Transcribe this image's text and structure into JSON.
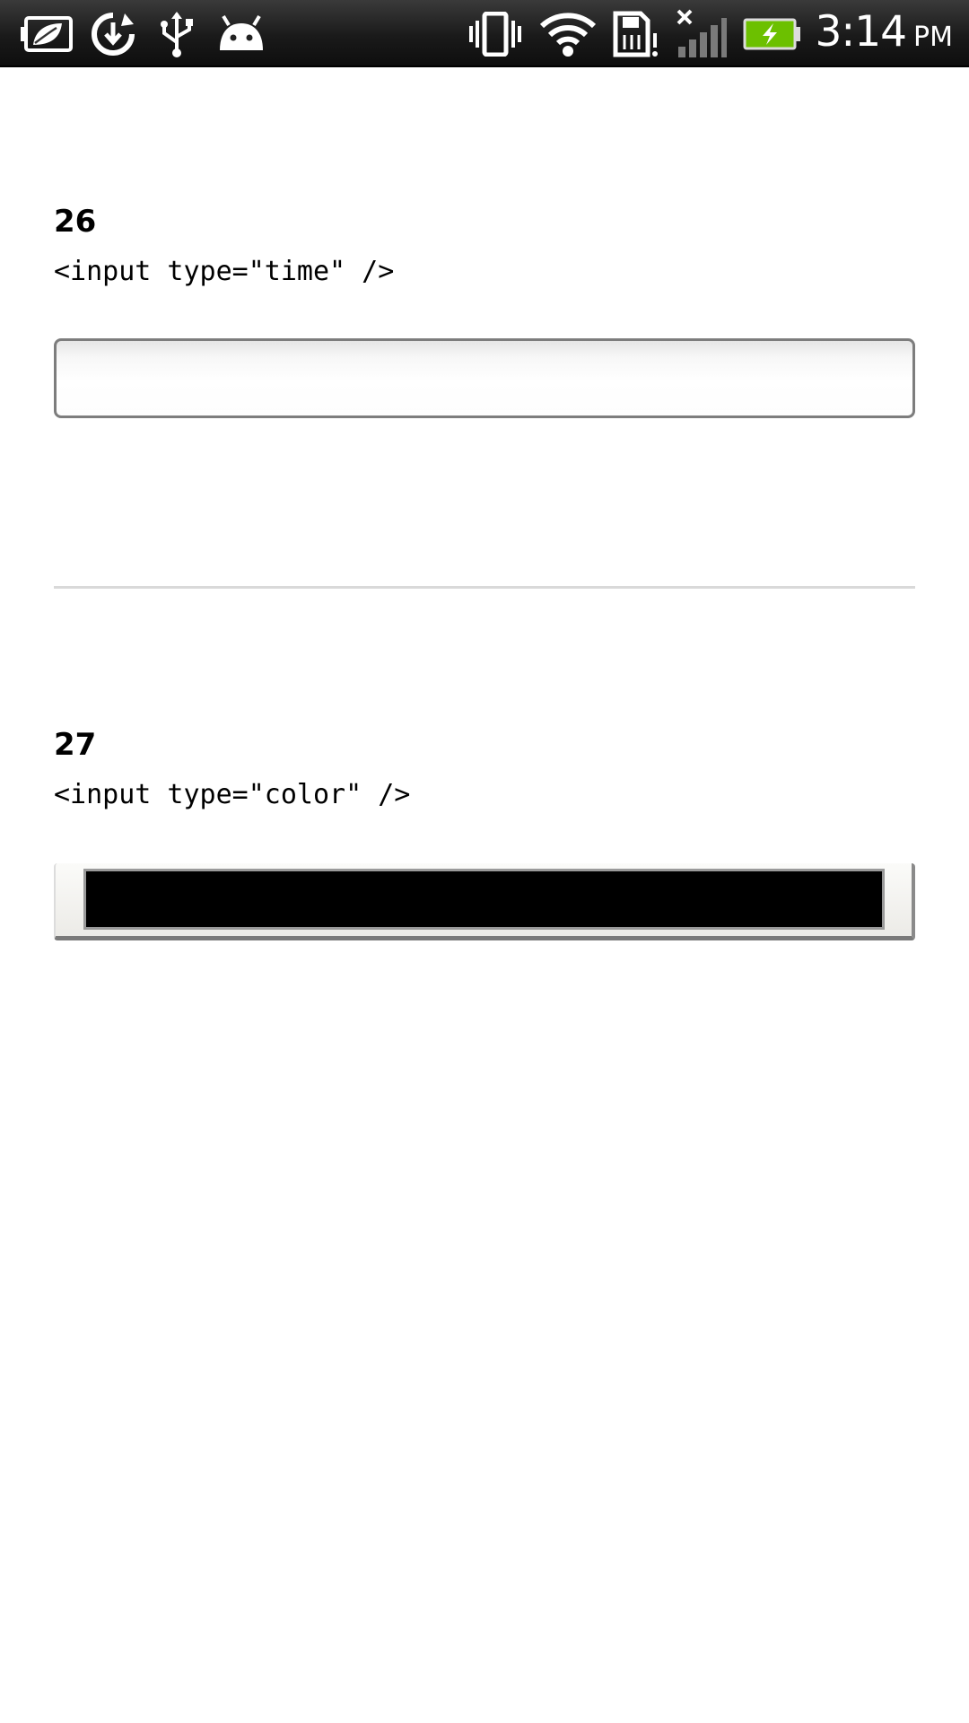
{
  "status_bar": {
    "time": "3:14",
    "ampm": "PM",
    "left_icons": [
      "leaf-notification-icon",
      "sync-icon",
      "usb-icon",
      "android-debug-icon"
    ],
    "right_icons": [
      "vibrate-icon",
      "wifi-icon",
      "sd-card-warning-icon",
      "no-signal-icon",
      "battery-charging-icon"
    ],
    "colors": {
      "background": "#1c1c1c",
      "battery_fill": "#6cc000",
      "icon": "#ffffff"
    }
  },
  "sections": [
    {
      "number": "26",
      "code": "<input type=\"time\" />",
      "input_type": "time",
      "value": ""
    },
    {
      "number": "27",
      "code": "<input type=\"color\" />",
      "input_type": "color",
      "value": "#000000"
    }
  ],
  "colors": {
    "page_background": "#ffffff",
    "divider": "#d9d9d9",
    "swatch": "#000000"
  }
}
